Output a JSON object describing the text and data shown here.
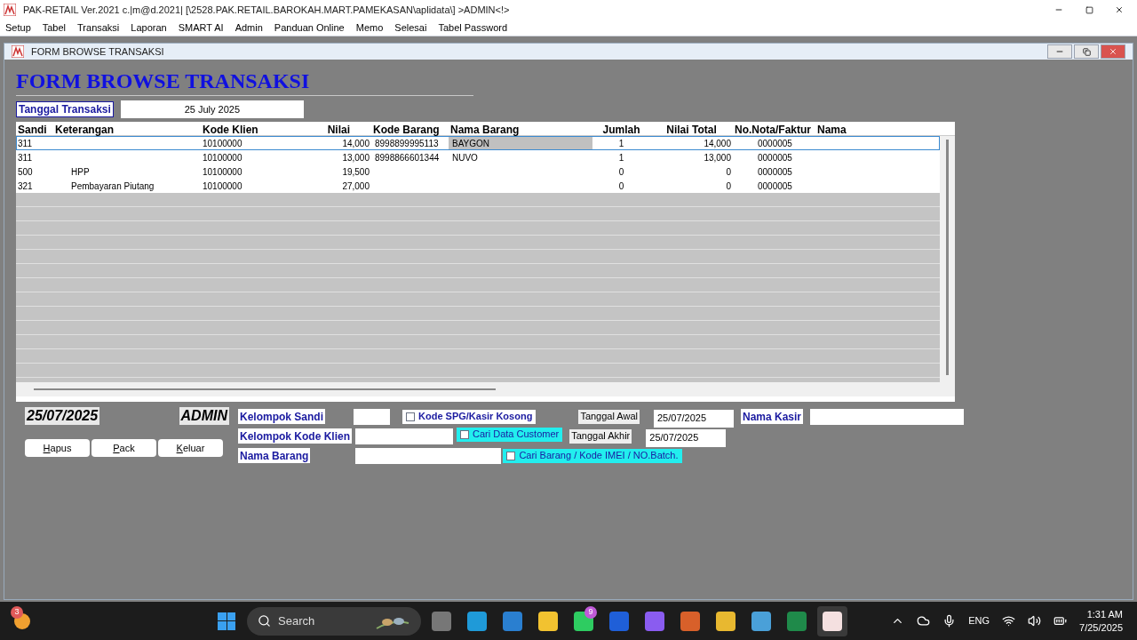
{
  "app": {
    "title": "PAK-RETAIL Ver.2021 c.|m@d.2021| [\\2528.PAK.RETAIL.BAROKAH.MART.PAMEKASAN\\aplidata\\] >ADMIN<!>",
    "menu": [
      "Setup",
      "Tabel",
      "Transaksi",
      "Laporan",
      "SMART AI",
      "Admin",
      "Panduan Online",
      "Memo",
      "Selesai",
      "Tabel Password"
    ]
  },
  "form": {
    "title": "FORM BROWSE TRANSAKSI",
    "heading": "FORM BROWSE TRANSAKSI",
    "date_label": "Tanggal Transaksi",
    "date_value": "25 July 2025"
  },
  "table": {
    "columns": [
      "Sandi",
      "Keterangan",
      "Kode Klien",
      "Nilai",
      "Kode Barang",
      "Nama Barang",
      "Jumlah",
      "Nilai Total",
      "No.Nota/Faktur",
      "Nama"
    ],
    "rows": [
      {
        "selected": true,
        "cells": [
          "311",
          "",
          "10100000",
          "14,000",
          "8998899995113",
          "BAYGON",
          "1",
          "14,000",
          "0000005",
          ""
        ]
      },
      {
        "selected": false,
        "cells": [
          "311",
          "",
          "10100000",
          "13,000",
          "8998866601344",
          "NUVO",
          "1",
          "13,000",
          "0000005",
          ""
        ]
      },
      {
        "selected": false,
        "cells": [
          "500",
          "HPP",
          "10100000",
          "19,500",
          "",
          "",
          "0",
          "0",
          "0000005",
          ""
        ]
      },
      {
        "selected": false,
        "cells": [
          "321",
          "Pembayaran Piutang",
          "10100000",
          "27,000",
          "",
          "",
          "0",
          "0",
          "0000005",
          ""
        ]
      }
    ]
  },
  "footer": {
    "date": "25/07/2025",
    "user": "ADMIN",
    "buttons": [
      "Hapus",
      "Pack",
      "Keluar"
    ],
    "filters": [
      {
        "label": "Kelompok Sandi",
        "checkbox": {
          "label": "Kode SPG/Kasir Kosong",
          "checked": false,
          "kind": "plain"
        }
      },
      {
        "label": "Kelompok Kode Klien",
        "checkbox": {
          "label": "Cari Data Customer",
          "checked": false,
          "kind": "highlight"
        }
      },
      {
        "label": "Nama Barang",
        "checkbox": {
          "label": "Cari Barang / Kode IMEI / NO.Batch.",
          "checked": false,
          "kind": "highlight"
        }
      }
    ],
    "start_label": "Tanggal Awal",
    "start_value": "25/07/2025",
    "end_label": "Tanggal Akhir",
    "end_value": "25/07/2025",
    "cashier_label": "Nama Kasir"
  },
  "taskbar": {
    "weather_badge": "3",
    "search_placeholder": "Search",
    "whatsapp_badge": "9",
    "language": "ENG",
    "time": "1:31 AM",
    "date": "7/25/2025"
  }
}
